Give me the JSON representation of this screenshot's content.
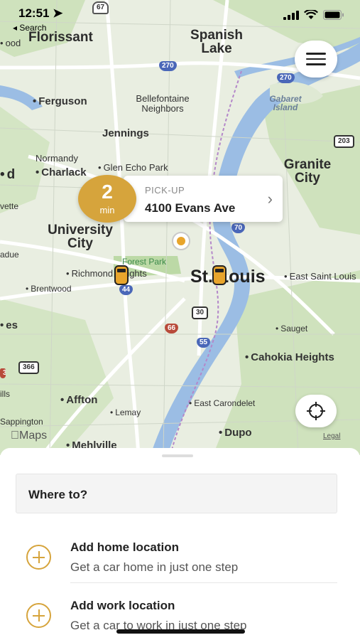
{
  "status_bar": {
    "time": "12:51",
    "back_label": "◂ Search"
  },
  "map": {
    "places": [
      {
        "name": "Florissant",
        "size": "big"
      },
      {
        "name": "Spanish Lake",
        "size": "big"
      },
      {
        "name": "Ferguson",
        "size": "med"
      },
      {
        "name": "Bellefontaine Neighbors",
        "size": "sm"
      },
      {
        "name": "Gabaret Island",
        "size": "water"
      },
      {
        "name": "Jennings",
        "size": "med"
      },
      {
        "name": "Normandy",
        "size": "sm"
      },
      {
        "name": "Charlack",
        "size": "med"
      },
      {
        "name": "Glen Echo Park",
        "size": "sm"
      },
      {
        "name": "Granite City",
        "size": "big"
      },
      {
        "name": "University City",
        "size": "big"
      },
      {
        "name": "Forest Park",
        "size": "green"
      },
      {
        "name": "Richmond Heights",
        "size": "sm"
      },
      {
        "name": "St. Louis",
        "size": "xl"
      },
      {
        "name": "East Saint Louis",
        "size": "sm"
      },
      {
        "name": "Brentwood",
        "size": "xs"
      },
      {
        "name": "Sauget",
        "size": "xs"
      },
      {
        "name": "Cahokia Heights",
        "size": "med"
      },
      {
        "name": "Affton",
        "size": "med"
      },
      {
        "name": "Lemay",
        "size": "xs"
      },
      {
        "name": "East Carondelet",
        "size": "xs"
      },
      {
        "name": "Sappington",
        "size": "xs"
      },
      {
        "name": "Dupo",
        "size": "med"
      },
      {
        "name": "Mehlville",
        "size": "med"
      },
      {
        "name": "ood",
        "size": "sm"
      },
      {
        "name": "d",
        "size": "big"
      },
      {
        "name": "vette",
        "size": "xs"
      },
      {
        "name": "adue",
        "size": "xs"
      },
      {
        "name": "es",
        "size": "med"
      },
      {
        "name": "ills",
        "size": "xs"
      }
    ],
    "shields": [
      "67",
      "270",
      "270",
      "203",
      "70",
      "44",
      "30",
      "66",
      "55",
      "366",
      "3"
    ],
    "attribution": "Maps",
    "legal": "Legal"
  },
  "menu_button": {
    "icon": "hamburger-icon"
  },
  "pickup": {
    "eta_number": "2",
    "eta_unit": "min",
    "label": "PICK-UP",
    "address": "4100 Evans Ave",
    "chevron": "›"
  },
  "locate_button": {
    "icon": "crosshair-icon"
  },
  "sheet": {
    "search_placeholder": "Where to?",
    "saved": [
      {
        "title": "Add home location",
        "subtitle": "Get a car home in just one step"
      },
      {
        "title": "Add work location",
        "subtitle": "Get a car to work in just one step"
      }
    ]
  },
  "colors": {
    "accent": "#d6a43c",
    "map_land": "#e9eee1",
    "park_green": "#c7dfb4",
    "river": "#9bbde4",
    "highway": "#ffffff"
  }
}
